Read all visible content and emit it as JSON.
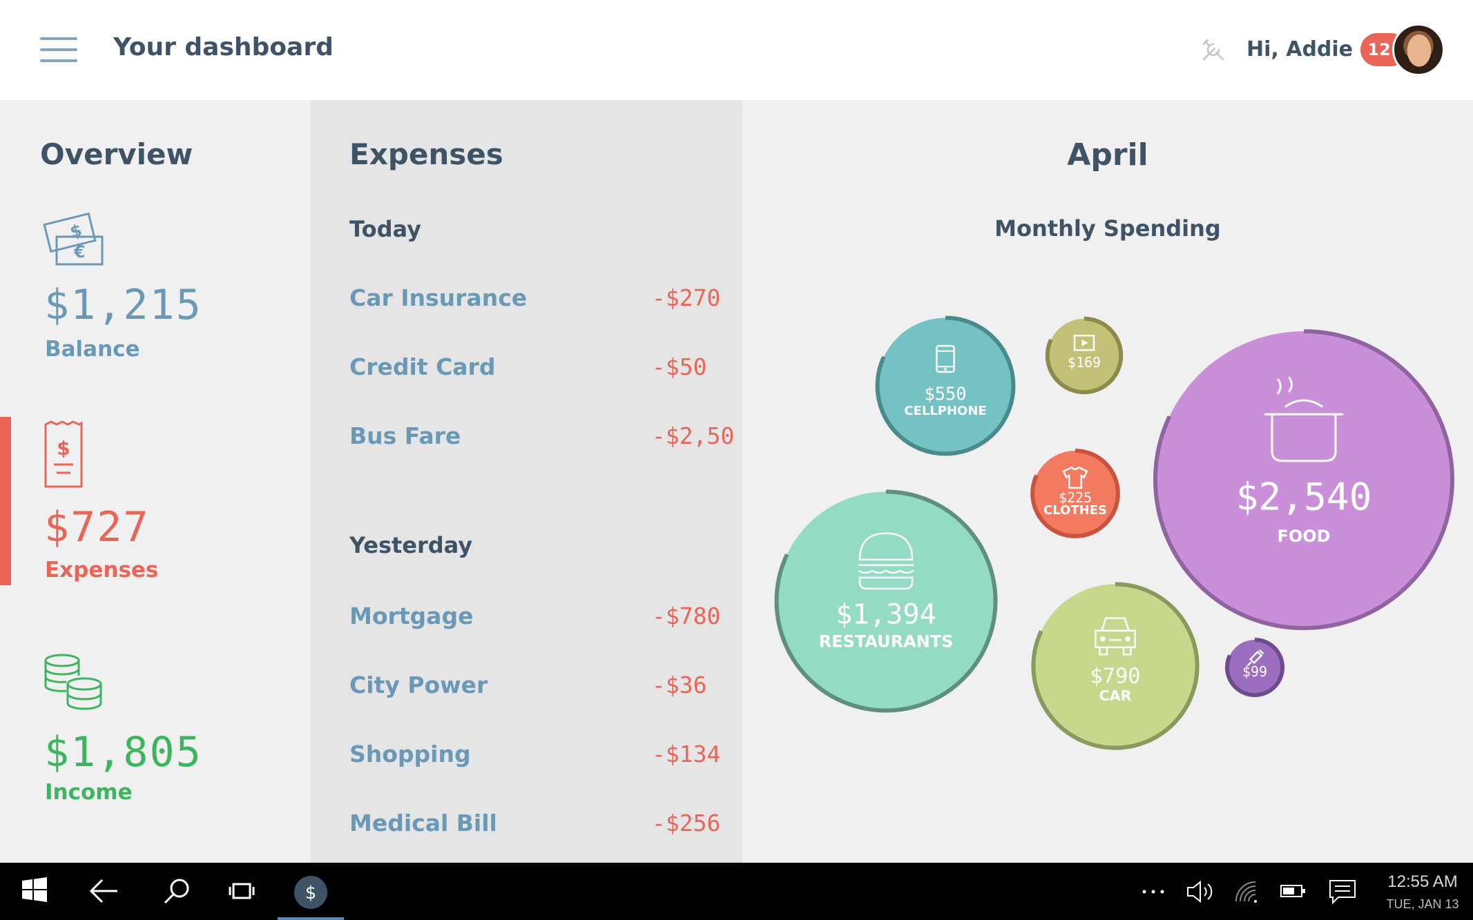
{
  "header": {
    "title": "Your dashboard",
    "greeting": "Hi, Addie",
    "notification_count": "12"
  },
  "overview": {
    "title": "Overview",
    "balance": {
      "value": "$1,215",
      "label": "Balance",
      "color": "#6a98b7",
      "icon": "money-bills-icon"
    },
    "expenses": {
      "value": "$727",
      "label": "Expenses",
      "color": "#e96557",
      "icon": "receipt-icon"
    },
    "income": {
      "value": "$1,805",
      "label": "Income",
      "color": "#3cb55e",
      "icon": "coins-icon"
    }
  },
  "expenses": {
    "title": "Expenses",
    "groups": [
      {
        "heading": "Today",
        "items": [
          {
            "name": "Car Insurance",
            "amount": "-$270"
          },
          {
            "name": "Credit Card",
            "amount": "-$50"
          },
          {
            "name": "Bus Fare",
            "amount": "-$2,50"
          }
        ]
      },
      {
        "heading": "Yesterday",
        "items": [
          {
            "name": "Mortgage",
            "amount": "-$780"
          },
          {
            "name": "City Power",
            "amount": "-$36"
          },
          {
            "name": "Shopping",
            "amount": "-$134"
          },
          {
            "name": "Medical Bill",
            "amount": "-$256"
          }
        ]
      }
    ]
  },
  "april": {
    "title": "April",
    "subtitle": "Monthly Spending"
  },
  "chart_data": {
    "type": "bubble",
    "title": "Monthly Spending",
    "series": [
      {
        "name": "CELLPHONE",
        "value": 550,
        "label": "$550",
        "color": "#74c2c3",
        "ring": "#4a8a8b",
        "icon": "phone-icon"
      },
      {
        "name": "",
        "value": 169,
        "label": "$169",
        "color": "#c2c177",
        "ring": "#8c8b4e",
        "icon": "film-icon"
      },
      {
        "name": "FOOD",
        "value": 2540,
        "label": "$2,540",
        "color": "#c98fd8",
        "ring": "#8f64a0",
        "icon": "cooking-pot-icon"
      },
      {
        "name": "CLOTHES",
        "value": 225,
        "label": "$225",
        "color": "#f27a60",
        "ring": "#c9533f",
        "icon": "tshirt-icon"
      },
      {
        "name": "RESTAURANTS",
        "value": 1394,
        "label": "$1,394",
        "color": "#93dbc2",
        "ring": "#5f8f7f",
        "icon": "burger-icon"
      },
      {
        "name": "CAR",
        "value": 790,
        "label": "$790",
        "color": "#c5d88c",
        "ring": "#8a9a5e",
        "icon": "car-icon"
      },
      {
        "name": "",
        "value": 99,
        "label": "$99",
        "color": "#9b6ec0",
        "ring": "#6e4a8f",
        "icon": "syringe-icon"
      }
    ]
  },
  "taskbar": {
    "time": "12:55 AM",
    "date": "TUE, JAN 13"
  }
}
